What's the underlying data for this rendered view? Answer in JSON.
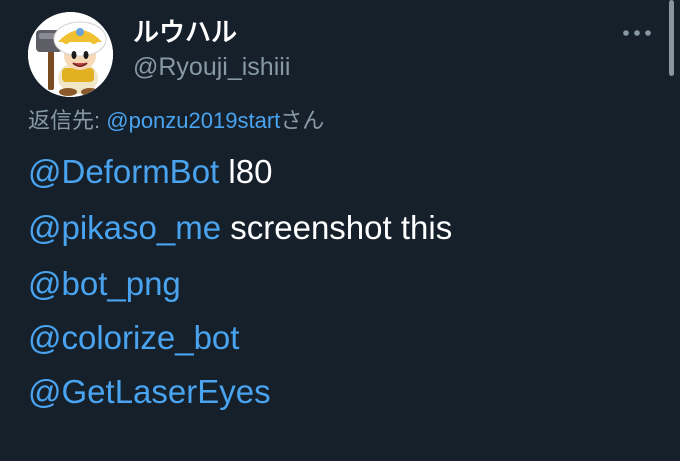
{
  "user": {
    "display_name": "ルウハル",
    "handle": "@Ryouji_ishiii",
    "avatar_icon": "toad-hammer-avatar-icon"
  },
  "menu": {
    "more_icon": "more-horizontal-icon",
    "more_glyph": "•••"
  },
  "reply": {
    "prefix": "返信先:",
    "target": "@ponzu2019start",
    "suffix": "さん"
  },
  "body": {
    "lines": [
      {
        "mention": "@DeformBot",
        "text": " l80"
      },
      {
        "mention": "@pikaso_me",
        "text": " screenshot this"
      },
      {
        "mention": "@bot_png",
        "text": ""
      },
      {
        "mention": "@colorize_bot",
        "text": ""
      },
      {
        "mention": "@GetLaserEyes",
        "text": ""
      }
    ]
  },
  "colors": {
    "background": "#15202b",
    "link": "#4aa3ef",
    "secondary_text": "#8899a6",
    "primary_text": "#ffffff"
  }
}
